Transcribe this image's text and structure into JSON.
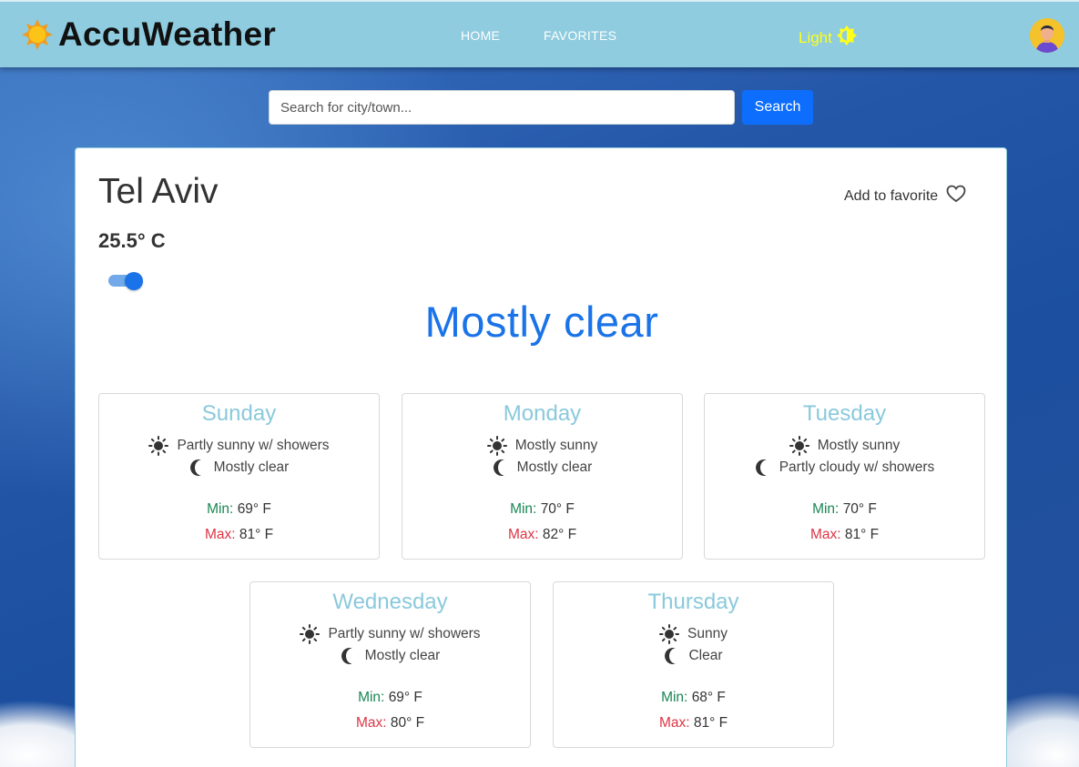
{
  "app": {
    "brand": "AccuWeather"
  },
  "nav": {
    "home": "HOME",
    "favorites": "FAVORITES",
    "theme_label": "Light"
  },
  "search": {
    "placeholder": "Search for city/town...",
    "button": "Search"
  },
  "current": {
    "city": "Tel Aviv",
    "temperature": "25.5° C",
    "add_favorite": "Add to favorite",
    "condition": "Mostly clear",
    "unit_toggle_on": true
  },
  "labels": {
    "min": "Min:",
    "max": "Max:"
  },
  "forecast": [
    {
      "day": "Sunday",
      "day_text": "Partly sunny w/ showers",
      "night_text": "Mostly clear",
      "min": "69° F",
      "max": "81° F"
    },
    {
      "day": "Monday",
      "day_text": "Mostly sunny",
      "night_text": "Mostly clear",
      "min": "70° F",
      "max": "82° F"
    },
    {
      "day": "Tuesday",
      "day_text": "Mostly sunny",
      "night_text": "Partly cloudy w/ showers",
      "min": "70° F",
      "max": "81° F"
    },
    {
      "day": "Wednesday",
      "day_text": "Partly sunny w/ showers",
      "night_text": "Mostly clear",
      "min": "69° F",
      "max": "80° F"
    },
    {
      "day": "Thursday",
      "day_text": "Sunny",
      "night_text": "Clear",
      "min": "68° F",
      "max": "81° F"
    }
  ],
  "icons": {
    "brand": "sun-icon",
    "theme": "brightness-icon",
    "favorite": "heart-outline-icon",
    "day": "sun-icon",
    "night": "moon-icon"
  },
  "colors": {
    "navbar": "#8fccdf",
    "theme_label": "#ffff1a",
    "accent": "#1a73e8",
    "search_button": "#0d6efd",
    "day_name": "#8ac9dc",
    "min_label": "#198754",
    "max_label": "#dc3545"
  }
}
